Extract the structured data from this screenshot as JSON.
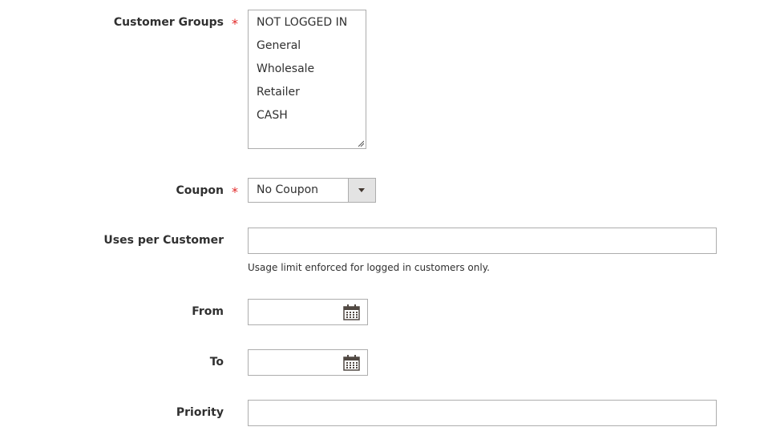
{
  "form": {
    "customer_groups": {
      "label": "Customer Groups",
      "required_mark": "*",
      "options": [
        "NOT LOGGED IN",
        "General",
        "Wholesale",
        "Retailer",
        "CASH"
      ]
    },
    "coupon": {
      "label": "Coupon",
      "required_mark": "*",
      "selected": "No Coupon"
    },
    "uses_per_customer": {
      "label": "Uses per Customer",
      "value": "",
      "note": "Usage limit enforced for logged in customers only."
    },
    "from": {
      "label": "From",
      "value": "",
      "icon": "calendar-icon"
    },
    "to": {
      "label": "To",
      "value": "",
      "icon": "calendar-icon"
    },
    "priority": {
      "label": "Priority",
      "value": ""
    }
  }
}
